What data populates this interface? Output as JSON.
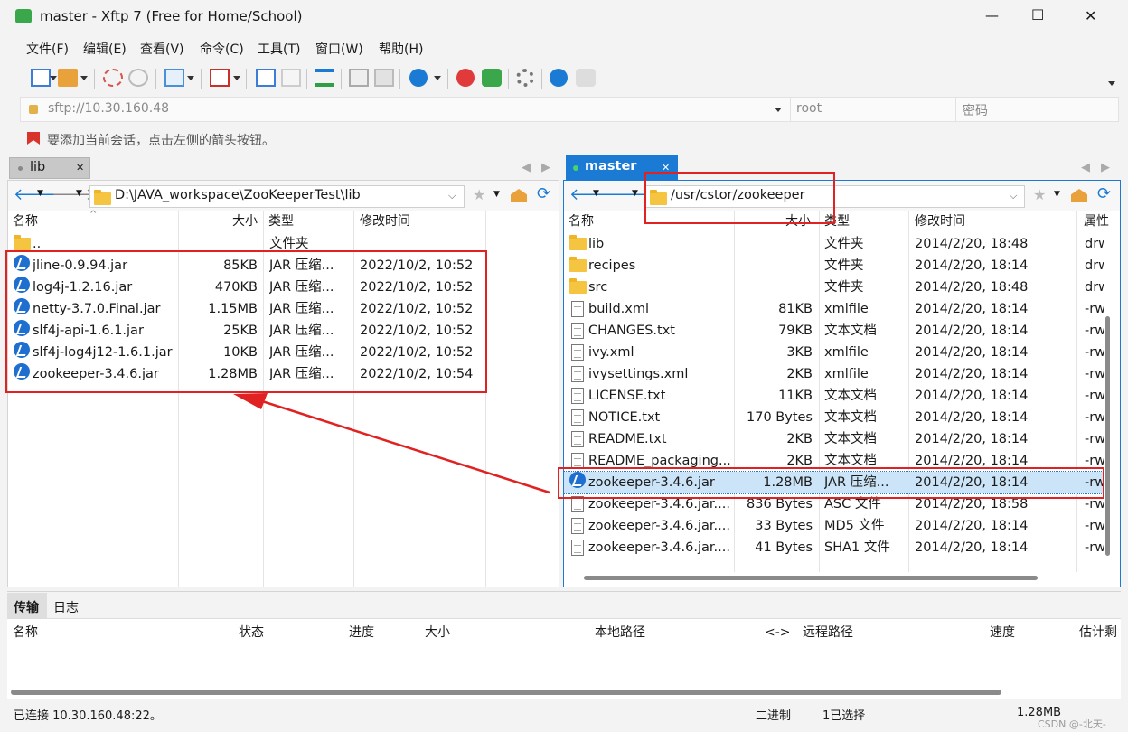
{
  "window": {
    "title": "master - Xftp 7 (Free for Home/School)",
    "controls": {
      "minimize": "—",
      "maximize": "☐",
      "close": "✕"
    }
  },
  "menu": [
    "文件(F)",
    "编辑(E)",
    "查看(V)",
    "命令(C)",
    "工具(T)",
    "窗口(W)",
    "帮助(H)"
  ],
  "address": {
    "url": "sftp://10.30.160.48",
    "user_placeholder": "root",
    "password_placeholder": "密码"
  },
  "hint": "要添加当前会话，点击左侧的箭头按钮。",
  "left": {
    "tab": "lib",
    "path": "D:\\JAVA_workspace\\ZooKeeperTest\\lib",
    "headers": [
      "名称",
      "大小",
      "类型",
      "修改时间"
    ],
    "parent": {
      "name": "..",
      "type": "文件夹"
    },
    "files": [
      {
        "name": "jline-0.9.94.jar",
        "size": "85KB",
        "type": "JAR 压缩...",
        "date": "2022/10/2, 10:52"
      },
      {
        "name": "log4j-1.2.16.jar",
        "size": "470KB",
        "type": "JAR 压缩...",
        "date": "2022/10/2, 10:52"
      },
      {
        "name": "netty-3.7.0.Final.jar",
        "size": "1.15MB",
        "type": "JAR 压缩...",
        "date": "2022/10/2, 10:52"
      },
      {
        "name": "slf4j-api-1.6.1.jar",
        "size": "25KB",
        "type": "JAR 压缩...",
        "date": "2022/10/2, 10:52"
      },
      {
        "name": "slf4j-log4j12-1.6.1.jar",
        "size": "10KB",
        "type": "JAR 压缩...",
        "date": "2022/10/2, 10:52"
      },
      {
        "name": "zookeeper-3.4.6.jar",
        "size": "1.28MB",
        "type": "JAR 压缩...",
        "date": "2022/10/2, 10:54"
      }
    ]
  },
  "right": {
    "tab": "master",
    "path": "/usr/cstor/zookeeper",
    "headers": [
      "名称",
      "大小",
      "类型",
      "修改时间",
      "属性"
    ],
    "files": [
      {
        "name": "lib",
        "size": "",
        "type": "文件夹",
        "date": "2014/2/20, 18:48",
        "attr": "drw",
        "icon": "folder"
      },
      {
        "name": "recipes",
        "size": "",
        "type": "文件夹",
        "date": "2014/2/20, 18:14",
        "attr": "drw",
        "icon": "folder"
      },
      {
        "name": "src",
        "size": "",
        "type": "文件夹",
        "date": "2014/2/20, 18:48",
        "attr": "drw",
        "icon": "folder"
      },
      {
        "name": "build.xml",
        "size": "81KB",
        "type": "xmlfile",
        "date": "2014/2/20, 18:14",
        "attr": "-rw",
        "icon": "doc"
      },
      {
        "name": "CHANGES.txt",
        "size": "79KB",
        "type": "文本文档",
        "date": "2014/2/20, 18:14",
        "attr": "-rw",
        "icon": "doc"
      },
      {
        "name": "ivy.xml",
        "size": "3KB",
        "type": "xmlfile",
        "date": "2014/2/20, 18:14",
        "attr": "-rw",
        "icon": "doc"
      },
      {
        "name": "ivysettings.xml",
        "size": "2KB",
        "type": "xmlfile",
        "date": "2014/2/20, 18:14",
        "attr": "-rw",
        "icon": "doc"
      },
      {
        "name": "LICENSE.txt",
        "size": "11KB",
        "type": "文本文档",
        "date": "2014/2/20, 18:14",
        "attr": "-rw",
        "icon": "doc"
      },
      {
        "name": "NOTICE.txt",
        "size": "170 Bytes",
        "type": "文本文档",
        "date": "2014/2/20, 18:14",
        "attr": "-rw",
        "icon": "doc"
      },
      {
        "name": "README.txt",
        "size": "2KB",
        "type": "文本文档",
        "date": "2014/2/20, 18:14",
        "attr": "-rw",
        "icon": "doc"
      },
      {
        "name": "README_packaging...",
        "size": "2KB",
        "type": "文本文档",
        "date": "2014/2/20, 18:14",
        "attr": "-rw",
        "icon": "doc"
      },
      {
        "name": "zookeeper-3.4.6.jar",
        "size": "1.28MB",
        "type": "JAR 压缩...",
        "date": "2014/2/20, 18:14",
        "attr": "-rw",
        "icon": "jar",
        "selected": true
      },
      {
        "name": "zookeeper-3.4.6.jar....",
        "size": "836 Bytes",
        "type": "ASC 文件",
        "date": "2014/2/20, 18:58",
        "attr": "-rw",
        "icon": "doc"
      },
      {
        "name": "zookeeper-3.4.6.jar....",
        "size": "33 Bytes",
        "type": "MD5 文件",
        "date": "2014/2/20, 18:14",
        "attr": "-rw",
        "icon": "doc"
      },
      {
        "name": "zookeeper-3.4.6.jar....",
        "size": "41 Bytes",
        "type": "SHA1 文件",
        "date": "2014/2/20, 18:14",
        "attr": "-rw",
        "icon": "doc"
      }
    ]
  },
  "transfer": {
    "tabs": [
      "传输",
      "日志"
    ],
    "headers": [
      "名称",
      "状态",
      "进度",
      "大小",
      "本地路径",
      "<->",
      "远程路径",
      "速度",
      "估计剩"
    ]
  },
  "status": {
    "connection": "已连接 10.30.160.48:22。",
    "mode": "二进制",
    "selected": "1已选择",
    "size": "1.28MB",
    "watermark": "CSDN @-北天-"
  },
  "colors": {
    "accent": "#1b7ad3",
    "annotation": "#e02222",
    "selected_row": "#cce4f7"
  }
}
